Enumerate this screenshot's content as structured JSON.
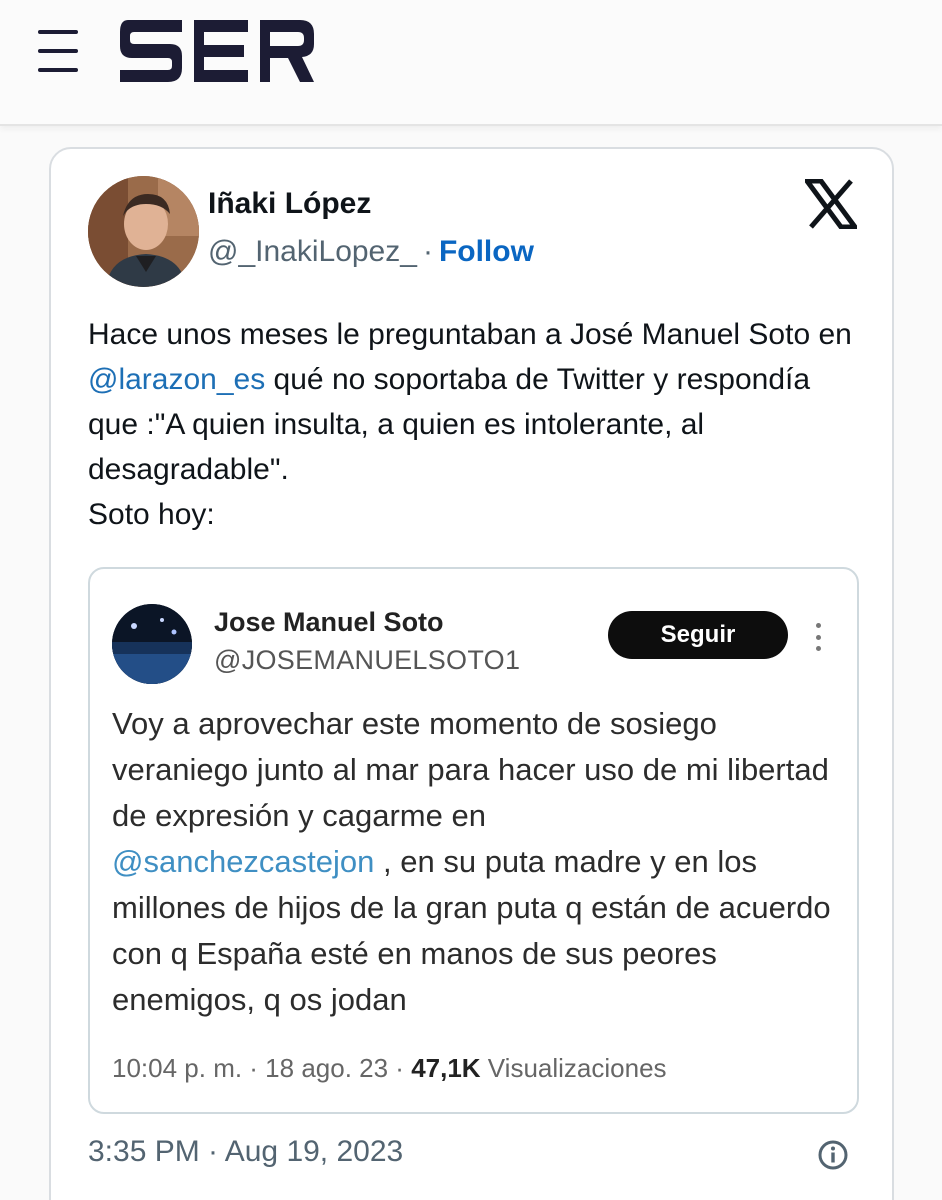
{
  "header": {
    "menu_icon": "hamburger-menu-icon",
    "logo_text": "SER"
  },
  "tweet": {
    "author_name": "Iñaki López",
    "author_handle": "@_InakiLopez_",
    "separator": "·",
    "follow_label": "Follow",
    "platform_icon": "x-logo-icon",
    "text": {
      "part1": "Hace unos meses le preguntaban a José Manuel Soto en ",
      "mention": "@larazon_es",
      "part2": " qué no soportaba de Twitter y respondía que :\"A quien insulta, a quien es intolerante, al desagradable\".",
      "line_last": "Soto hoy:"
    },
    "timestamp": "3:35 PM · Aug 19, 2023",
    "info_icon": "info-circle-icon"
  },
  "quoted": {
    "author_name": "Jose Manuel Soto",
    "author_handle": "@JOSEMANUELSOTO1",
    "follow_label": "Seguir",
    "more_icon": "more-vertical-icon",
    "text_part1": "Voy a aprovechar este momento de sosiego veraniego junto al mar para hacer uso de mi libertad de expresión y cagarme en",
    "mention": "@sanchezcastejon",
    "text_part2": " , en su puta madre y en los millones de hijos de la gran puta q están de acuerdo con q España esté en manos de sus peores enemigos, q os jodan",
    "meta_time": "10:04 p. m. · 18 ago. 23 · ",
    "views_count": "47,1K",
    "views_label": " Visualizaciones"
  },
  "colors": {
    "link": "#1d6fb5",
    "follow": "#0a66c2",
    "logo": "#1c1c34"
  }
}
